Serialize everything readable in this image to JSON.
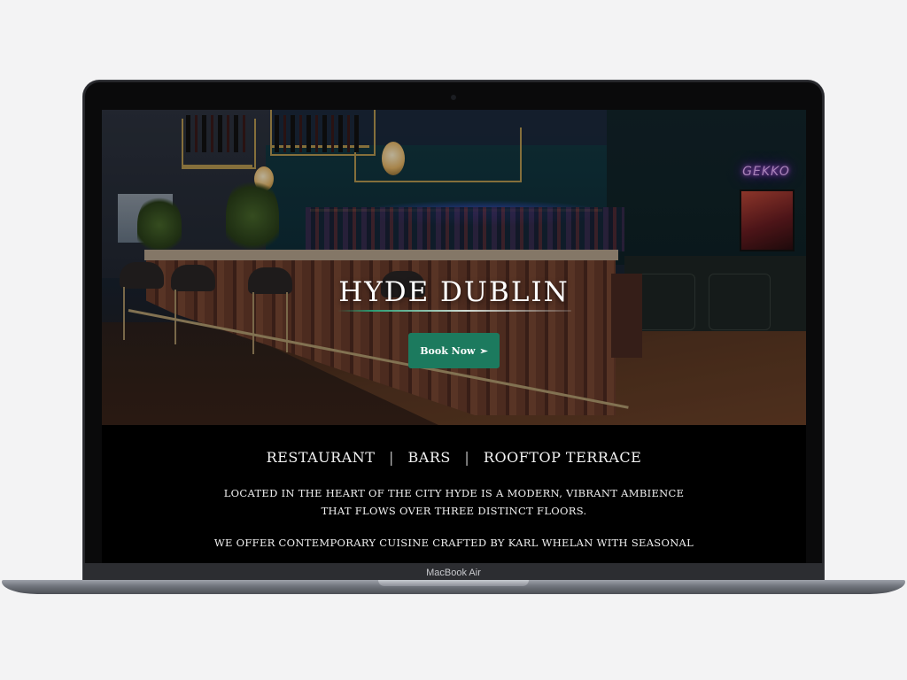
{
  "device": {
    "model_label": "MacBook Air"
  },
  "hero": {
    "title": "HYDE DUBLIN",
    "neon_sign": "GEKKO",
    "book_button": {
      "label": "Book Now",
      "icon": "arrow-right-icon",
      "color": "#1c7a5e"
    }
  },
  "nav": {
    "items": [
      "RESTAURANT",
      "BARS",
      "ROOFTOP TERRACE"
    ],
    "separator": "|"
  },
  "content": {
    "paragraph1_line1": "LOCATED IN THE HEART OF THE CITY HYDE IS A MODERN, VIBRANT AMBIENCE",
    "paragraph1_line2": "THAT FLOWS OVER THREE DISTINCT FLOORS.",
    "paragraph2_line1": "WE OFFER CONTEMPORARY CUISINE CRAFTED BY KARL WHELAN WITH SEASONAL"
  },
  "colors": {
    "page_background": "#000000",
    "accent": "#1c7a5e",
    "text": "#ffffff"
  }
}
